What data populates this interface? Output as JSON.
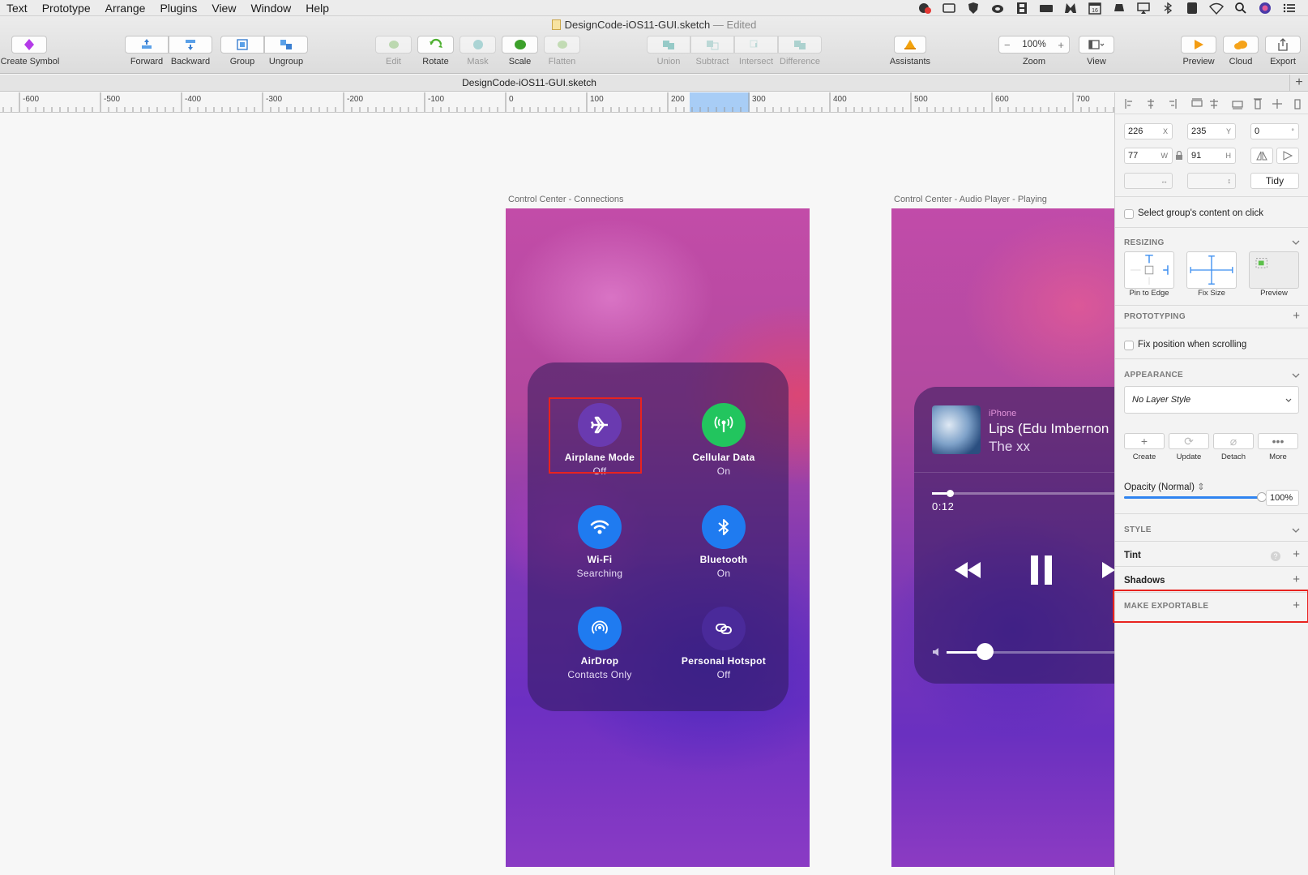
{
  "menubar": {
    "items": [
      "Text",
      "Prototype",
      "Arrange",
      "Plugins",
      "View",
      "Window",
      "Help"
    ],
    "status_icons": [
      "notification-badge-icon",
      "screen-icon",
      "shield-icon",
      "creative-cloud-icon",
      "film-icon",
      "dock-icon",
      "malwarebytes-icon",
      "calendar-icon",
      "drive-icon",
      "airplay-icon",
      "bluetooth-icon",
      "app-icon",
      "wifi-icon",
      "search-icon",
      "siri-icon",
      "list-icon"
    ]
  },
  "toolbar": {
    "doc_title": "DesignCode-iOS11-GUI.sketch",
    "doc_status": "— Edited",
    "create_symbol": "Create Symbol",
    "forward": "Forward",
    "backward": "Backward",
    "group": "Group",
    "ungroup": "Ungroup",
    "edit": "Edit",
    "rotate": "Rotate",
    "mask": "Mask",
    "scale": "Scale",
    "flatten": "Flatten",
    "union": "Union",
    "subtract": "Subtract",
    "intersect": "Intersect",
    "difference": "Difference",
    "assistants": "Assistants",
    "zoom_value": "100%",
    "zoom": "Zoom",
    "view": "View",
    "preview": "Preview",
    "cloud": "Cloud",
    "export": "Export"
  },
  "tabbar": {
    "title": "DesignCode-iOS11-GUI.sketch",
    "add": "+"
  },
  "ruler": {
    "labels": [
      "-600",
      "-500",
      "-400",
      "-300",
      "-200",
      "-100",
      "0",
      "100",
      "200",
      "300",
      "400",
      "500",
      "600",
      "700"
    ]
  },
  "canvas": {
    "artboard1": {
      "label": "Control Center - Connections",
      "tiles": [
        {
          "title": "Airplane Mode",
          "status": "Off",
          "icon": "airplane-icon",
          "color": "#6a3ab0"
        },
        {
          "title": "Cellular Data",
          "status": "On",
          "icon": "antenna-icon",
          "color": "#22c55e"
        },
        {
          "title": "Wi-Fi",
          "status": "Searching",
          "icon": "wifi-icon",
          "color": "#1f7bf0"
        },
        {
          "title": "Bluetooth",
          "status": "On",
          "icon": "bluetooth-icon",
          "color": "#1f7bf0"
        },
        {
          "title": "AirDrop",
          "status": "Contacts Only",
          "icon": "airdrop-icon",
          "color": "#1f7bf0"
        },
        {
          "title": "Personal Hotspot",
          "status": "Off",
          "icon": "hotspot-icon",
          "color": "#4a2a9a"
        }
      ]
    },
    "artboard2": {
      "label": "Control Center - Audio Player - Playing",
      "source": "iPhone",
      "track": "Lips (Edu Imbernon",
      "artist": "The xx",
      "time": "0:12"
    }
  },
  "inspector": {
    "x": "226",
    "x_suffix": "X",
    "y": "235",
    "y_suffix": "Y",
    "rotation": "0",
    "rotation_suffix": "°",
    "w": "77",
    "w_suffix": "W",
    "h": "91",
    "h_suffix": "H",
    "tidy": "Tidy",
    "select_group": "Select group's content on click",
    "resizing": "RESIZING",
    "pin_to_edge": "Pin to Edge",
    "fix_size": "Fix Size",
    "preview": "Preview",
    "prototyping": "PROTOTYPING",
    "fix_position": "Fix position when scrolling",
    "appearance": "APPEARANCE",
    "layer_style": "No Layer Style",
    "create": "Create",
    "update": "Update",
    "detach": "Detach",
    "more": "More",
    "opacity_label": "Opacity (Normal)",
    "opacity_value": "100%",
    "opacity_level": 1.0,
    "style": "STYLE",
    "tint": "Tint",
    "shadows": "Shadows",
    "make_exportable": "MAKE EXPORTABLE"
  }
}
